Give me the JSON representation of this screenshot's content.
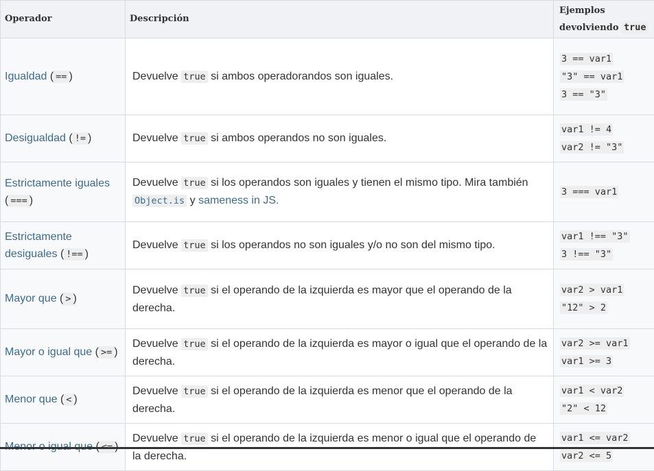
{
  "header": {
    "col1": "Operador",
    "col2": "Descripción",
    "col3_text": "Ejemplos devolviendo",
    "col3_code": "true"
  },
  "rows": [
    {
      "name": "Igualdad",
      "symbol": "==",
      "desc_pre": "Devuelve",
      "desc_code": "true",
      "desc_post": "si ambos operadorandos son iguales.",
      "examples": [
        "3 == var1",
        "\"3\" == var1",
        "3 == \"3\""
      ]
    },
    {
      "name": "Desigualdad",
      "symbol": "!=",
      "desc_pre": "Devuelve",
      "desc_code": "true",
      "desc_post": "si ambos operandos no son iguales.",
      "examples": [
        "var1 != 4",
        "var2 != \"3\""
      ]
    },
    {
      "name": "Estrictamente iguales",
      "symbol": "===",
      "desc_pre": "Devuelve",
      "desc_code": "true",
      "desc_post": "si los operandos son iguales y tienen el mismo tipo. Mira también",
      "link_code": "Object.is",
      "link_join": "y",
      "link_text": "sameness in JS",
      "link_end": ".",
      "examples": [
        "3 === var1"
      ]
    },
    {
      "name": "Estrictamente desiguales",
      "symbol": "!==",
      "desc_pre": "Devuelve",
      "desc_code": "true",
      "desc_post": "si los operandos no son iguales y/o no son del mismo tipo.",
      "examples": [
        "var1 !== \"3\"",
        "3 !== \"3\""
      ]
    },
    {
      "name": "Mayor que",
      "symbol": ">",
      "desc_pre": "Devuelve",
      "desc_code": "true",
      "desc_post": "si el operando de la izquierda es mayor que el operando de la derecha.",
      "examples": [
        "var2 > var1",
        "\"12\" > 2"
      ]
    },
    {
      "name": "Mayor o igual que",
      "symbol": ">=",
      "desc_pre": "Devuelve",
      "desc_code": "true",
      "desc_post": "si el operando de la izquierda es mayor o igual que el operando de la derecha.",
      "examples": [
        "var2 >= var1",
        "var1 >= 3"
      ]
    },
    {
      "name": "Menor que",
      "symbol": "<",
      "desc_pre": "Devuelve",
      "desc_code": "true",
      "desc_post": "si el operando de la izquierda es menor que el operando de la derecha.",
      "examples": [
        "var1 < var2",
        "\"2\" < 12"
      ]
    },
    {
      "name": "Menor o igual que",
      "symbol": "<=",
      "desc_pre": "Devuelve",
      "desc_code": "true",
      "desc_post": "si el operando de la izquierda es menor o igual que el operando de la derecha.",
      "examples": [
        "var1 <= var2",
        "var2 <= 5"
      ]
    }
  ]
}
